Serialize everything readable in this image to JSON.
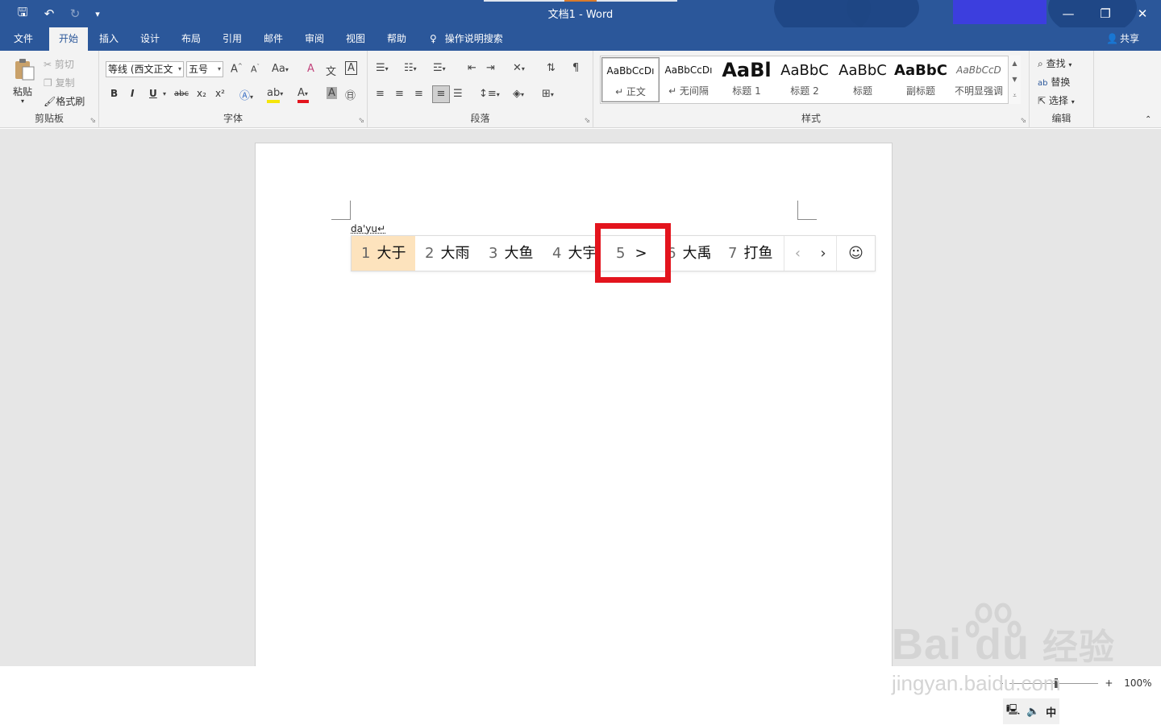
{
  "window": {
    "title": "文档1  -  Word",
    "controls": {
      "minimize": "—",
      "restore": "❐",
      "close": "✕"
    }
  },
  "quick_access": {
    "save": "🖫",
    "undo": "↶",
    "redo": "↻",
    "customize": "▾"
  },
  "tabs": [
    {
      "label": "文件",
      "active": false
    },
    {
      "label": "开始",
      "active": true
    },
    {
      "label": "插入",
      "active": false
    },
    {
      "label": "设计",
      "active": false
    },
    {
      "label": "布局",
      "active": false
    },
    {
      "label": "引用",
      "active": false
    },
    {
      "label": "邮件",
      "active": false
    },
    {
      "label": "审阅",
      "active": false
    },
    {
      "label": "视图",
      "active": false
    },
    {
      "label": "帮助",
      "active": false
    }
  ],
  "tell_me": "操作说明搜索",
  "share": "共享",
  "ribbon": {
    "clipboard": {
      "label": "剪贴板",
      "paste": "粘贴",
      "cut": "剪切",
      "copy": "复制",
      "format_painter": "格式刷"
    },
    "font": {
      "label": "字体",
      "font_name": "等线 (西文正文",
      "font_size": "五号",
      "grow": "A",
      "shrink": "A",
      "change_case": "Aa",
      "clear": "A",
      "phonetic": "文",
      "border": "A",
      "bold": "B",
      "italic": "I",
      "underline": "U",
      "strike": "abc",
      "subscript": "x₂",
      "superscript": "x²"
    },
    "paragraph": {
      "label": "段落"
    },
    "styles": {
      "label": "样式",
      "items": [
        {
          "preview": "AaBbCcDı",
          "name": "↵ 正文",
          "selected": true
        },
        {
          "preview": "AaBbCcDı",
          "name": "↵ 无间隔",
          "selected": false
        },
        {
          "preview": "AaBl",
          "name": "标题 1",
          "selected": false
        },
        {
          "preview": "AaBbC",
          "name": "标题 2",
          "selected": false
        },
        {
          "preview": "AaBbC",
          "name": "标题",
          "selected": false
        },
        {
          "preview": "AaBbC",
          "name": "副标题",
          "selected": false
        },
        {
          "preview": "AaBbCcD",
          "name": "不明显强调",
          "selected": false
        }
      ]
    },
    "editing": {
      "label": "编辑",
      "find": "查找",
      "replace": "替换",
      "select": "选择"
    }
  },
  "document": {
    "typed_text": "da'yu↵"
  },
  "ime": {
    "candidates": [
      {
        "num": "1",
        "text": "大于",
        "selected": true
      },
      {
        "num": "2",
        "text": "大雨",
        "selected": false
      },
      {
        "num": "3",
        "text": "大鱼",
        "selected": false
      },
      {
        "num": "4",
        "text": "大宇",
        "selected": false
      },
      {
        "num": "5",
        "text": ">",
        "selected": false
      },
      {
        "num": "6",
        "text": "大禹",
        "selected": false
      },
      {
        "num": "7",
        "text": "打鱼",
        "selected": false
      }
    ],
    "prev": "‹",
    "next": "›",
    "emoji": "☺"
  },
  "status": {
    "zoom": "100%",
    "minus": "-",
    "plus": "+"
  },
  "tray": {
    "network": "🖳",
    "volume": "🔈",
    "ime_mode": "中"
  },
  "watermark": {
    "brand": "Bai  du",
    "brand_cn": "经验",
    "url": "jingyan.baidu.com"
  },
  "colors": {
    "word_blue": "#2b579a",
    "highlight_red": "#e3141d",
    "candidate_selected": "#fde3bd"
  }
}
